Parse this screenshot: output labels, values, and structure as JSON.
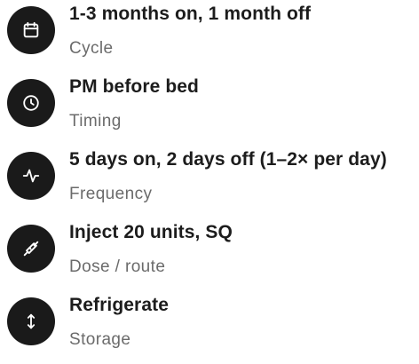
{
  "details": [
    {
      "icon": "calendar-icon",
      "title": "1-3 months on, 1 month off",
      "label": "Cycle"
    },
    {
      "icon": "clock-icon",
      "title": "PM before bed",
      "label": "Timing"
    },
    {
      "icon": "activity-icon",
      "title": "5 days on, 2 days off (1–2× per day)",
      "label": "Frequency"
    },
    {
      "icon": "syringe-icon",
      "title": "Inject 20 units, SQ",
      "label": "Dose / route"
    },
    {
      "icon": "arrows-vertical-icon",
      "title": "Refrigerate",
      "label": "Storage"
    }
  ],
  "colors": {
    "icon_bg": "#1a1a1a",
    "icon_fg": "#ffffff",
    "title": "#1c1c1c",
    "subtitle": "#6b6b6b"
  }
}
